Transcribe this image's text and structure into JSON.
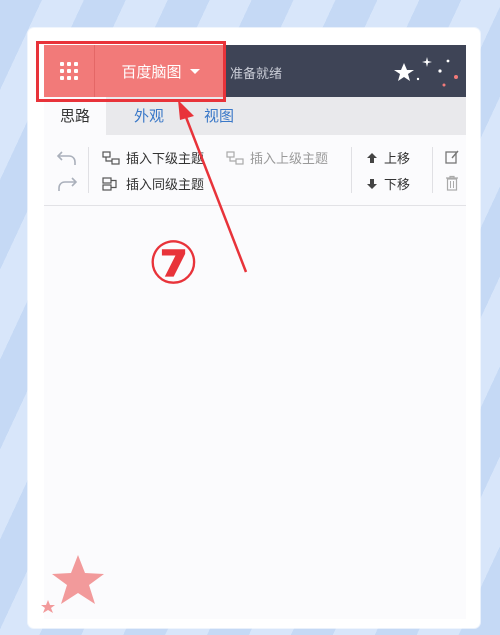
{
  "app": {
    "brand_label": "百度脑图",
    "status": "准备就绪"
  },
  "tabs": [
    {
      "label": "思路",
      "active": true
    },
    {
      "label": "外观",
      "active": false
    },
    {
      "label": "视图",
      "active": false
    }
  ],
  "toolbar": {
    "insert_child": "插入下级主题",
    "insert_parent": "插入上级主题",
    "insert_sibling": "插入同级主题",
    "move_up": "上移",
    "move_down": "下移"
  },
  "annotation": {
    "step": "⑦",
    "color": "#e8333a"
  },
  "colors": {
    "header_bg": "#3e4456",
    "brand_bg": "#f27a79",
    "tab_link": "#3a78c8"
  }
}
